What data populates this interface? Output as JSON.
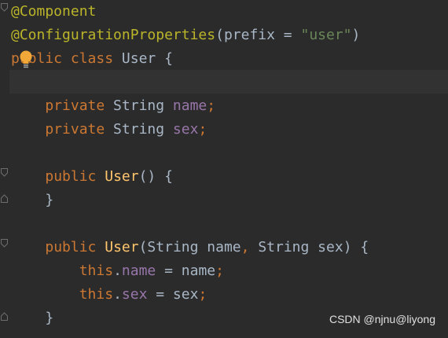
{
  "code": {
    "line1": {
      "annotation": "@Component"
    },
    "line2": {
      "annotation": "@ConfigurationProperties",
      "open_paren": "(",
      "param": "prefix",
      "equals": " = ",
      "value": "\"user\"",
      "close_paren": ")"
    },
    "line3": {
      "kw_public": "public",
      "space1": " ",
      "kw_class": "class",
      "space2": " ",
      "name": "User",
      "brace": " {"
    },
    "line5": {
      "indent": "    ",
      "kw_private": "private",
      "type": " String ",
      "field": "name",
      "semi": ";"
    },
    "line6": {
      "indent": "    ",
      "kw_private": "private",
      "type": " String ",
      "field": "sex",
      "semi": ";"
    },
    "line8": {
      "indent": "    ",
      "kw_public": "public",
      "space": " ",
      "ctor": "User",
      "rest": "() {"
    },
    "line9": {
      "text": "    }"
    },
    "line11": {
      "indent": "    ",
      "kw_public": "public",
      "space": " ",
      "ctor": "User",
      "params_a": "(String name",
      "comma": ",",
      "params_b": " String sex) {"
    },
    "line12": {
      "indent": "        ",
      "kw_this": "this",
      "dot": ".",
      "field": "name",
      "assign": " = name",
      "semi": ";"
    },
    "line13": {
      "indent": "        ",
      "kw_this": "this",
      "dot": ".",
      "field": "sex",
      "assign": " = sex",
      "semi": ";"
    },
    "line14": {
      "text": "    }"
    }
  },
  "watermark": "CSDN @njnu@liyong",
  "colors": {
    "background": "#2b2b2b",
    "annotation": "#bbb529",
    "keyword": "#cc7832",
    "string": "#6a8759",
    "field": "#9876aa",
    "method": "#ffc66d",
    "text": "#a9b7c6",
    "bulb": "#f2a838"
  },
  "icons": {
    "fold": "fold-arrow-icon",
    "intention": "lightbulb-icon"
  }
}
